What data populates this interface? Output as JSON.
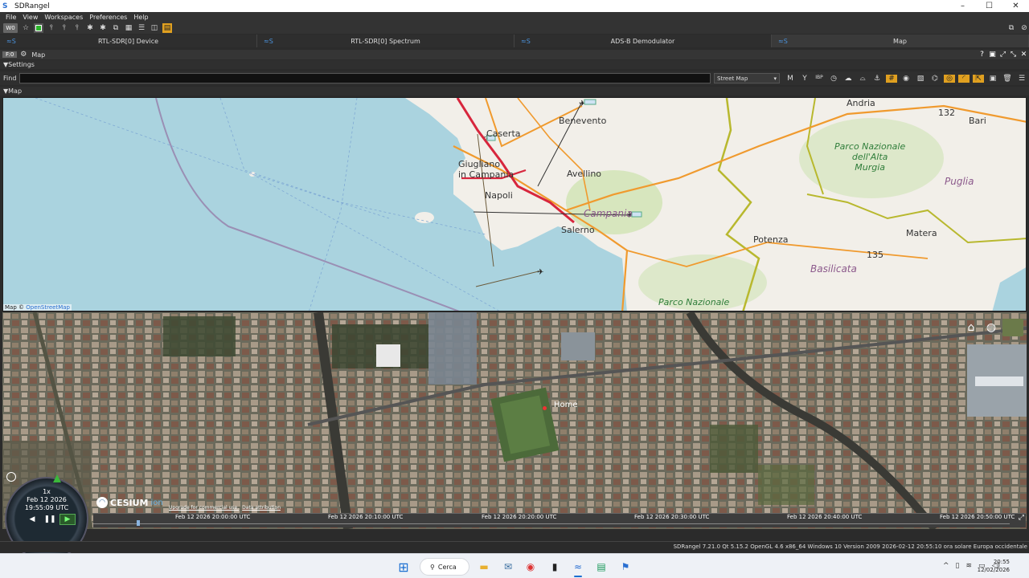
{
  "window": {
    "title": "SDRangel"
  },
  "menu": [
    "File",
    "View",
    "Workspaces",
    "Preferences",
    "Help"
  ],
  "toolbar": {
    "workspace_badge": "W0"
  },
  "tabs": [
    {
      "label": "RTL-SDR[0] Device"
    },
    {
      "label": "RTL-SDR[0] Spectrum"
    },
    {
      "label": "ADS-B Demodulator"
    },
    {
      "label": "Map"
    }
  ],
  "map_panel": {
    "workspace_badge": "F:0",
    "title": "Map",
    "settings_label": "Settings",
    "find_label": "Find",
    "find_value": "",
    "map_type": "Street Map",
    "map_section_label": "Map"
  },
  "map2d": {
    "attribution_prefix": "Map ©",
    "attribution_link": "OpenStreetMap",
    "labels": {
      "benevento": "Benevento",
      "caserta": "Caserta",
      "giugliano": "Giugliano\nin Campania",
      "napoli": "Napoli",
      "avellino": "Avellino",
      "campania": "Campania",
      "salerno": "Salerno",
      "potenza": "Potenza",
      "matera": "Matera",
      "bari": "Bari",
      "andria": "Andria",
      "puglia": "Puglia",
      "basilicata": "Basilicata",
      "road_132": "132",
      "road_135": "135",
      "parco_alta_murgia": "Parco Nazionale\ndell'Alta\nMurgia",
      "parco_nazionale": "Parco Nazionale"
    }
  },
  "map3d": {
    "home_label": "Home",
    "clock": {
      "speed": "1x",
      "date": "Feb 12 2026",
      "time": "19:55:09 UTC"
    },
    "cesium": {
      "name": "CESIUM",
      "ion": "ion"
    },
    "credits": [
      "Upgrade for commercial use.",
      "Data attribution"
    ],
    "timeline_ticks": [
      "Feb 12 2026 20:00:00 UTC",
      "Feb 12 2026 20:10:00 UTC",
      "Feb 12 2026 20:20:00 UTC",
      "Feb 12 2026 20:30:00 UTC",
      "Feb 12 2026 20:40:00 UTC",
      "Feb 12 2026 20:50:00 UTC"
    ]
  },
  "statusbar": {
    "text": "SDRangel 7.21.0 Qt 5.15.2 OpenGL 4.6 x86_64 Windows 10 Version 2009 2026-02-12 20:55:10 ora solare Europa occidentale"
  },
  "taskbar": {
    "search_label": "Cerca",
    "time": "20:55",
    "date": "12/02/2026"
  },
  "colors": {
    "accent": "#e0a020",
    "map_water": "#aad3df",
    "land": "#f2efe9",
    "road_major": "#d7263d",
    "road_primary": "#f09a2e",
    "regional_border": "#b8b82e"
  }
}
